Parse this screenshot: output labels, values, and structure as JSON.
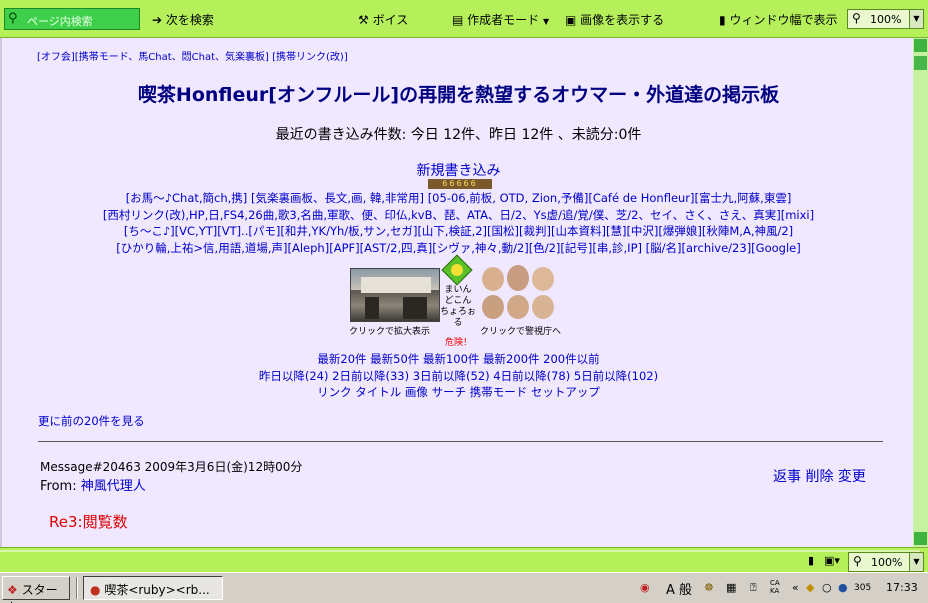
{
  "toolbar": {
    "search_placeholder": "ページ内検索",
    "find_next": "次を検索",
    "voice": "ボイス",
    "author_mode": "作成者モード",
    "show_images": "画像を表示する",
    "fit_width": "ウィンドウ幅で表示",
    "zoom": "100%"
  },
  "page": {
    "top_links": "[オフ会][携帯モード、馬Chat、悶Chat、気楽裏板] [携帯リンク(改)]",
    "title": "喫茶Honfleur[オンフルール]の再開を熱望するオウマー・外道達の掲示板",
    "stats": "最近の書き込み件数: 今日 12件、昨日 12件 、未読分:0件",
    "new_post": "新規書き込み",
    "counter": "66666",
    "link_rows": [
      "[お馬～♪Chat,簡ch,携] [気楽裏画板、長文,画, 韓,非常用] [05-06,前板, OTD, Zion,予備][Café de Honfleur][富士九,阿蘇,東雲]",
      "[西村リンク(改),HP,日,FS4,26曲,歌3,名曲,軍歌、便、印仏,kvB、琵、ATA、日/2、Ys虚/追/覚/僕、芝/2、セイ、さく、さえ、真実][mixi]",
      "[ち～こ♪][VC,YT][VT]..[パモ][和井,YK/Yh/板,サン,セガ][山下,検証,2][国松][裁判][山本資料][慧][中沢][爆弾娘][秋陣M,A,神風/2]",
      "[ひかり輪,上祐>信,用語,道場,声][Aleph][APF][AST/2,四,真][シヴァ,神々,動/2][色/2][記号][串,診,IP] [脳/名][archive/23][Google]"
    ],
    "img_caption_left": "クリックで拡大表示",
    "sign_text": [
      "まいん",
      "どこん",
      "ちょろぉ",
      "る"
    ],
    "danger": "危険！",
    "img_caption_right": "クリックで警視庁へ",
    "recent_row": "最新20件 最新50件 最新100件 最新200件 200件以前",
    "days_row": "昨日以降(24) 2日前以降(33) 3日前以降(52) 4日前以降(78) 5日前以降(102)",
    "nav_row": "リンク タイトル 画像 サーチ 携帯モード セットアップ",
    "prev20": "更に前の20件を見る",
    "message_line": "Message#20463 2009年3月6日(金)12時00分",
    "from_label": "From:",
    "from_name": "神風代理人",
    "actions": "返事 削除 変更",
    "subject": "Re3:閲覧数"
  },
  "status": {
    "zoom": "100%"
  },
  "taskbar": {
    "start": "スタート",
    "task": "喫茶<ruby><rb...",
    "ime": "A 般",
    "tray_num": "305",
    "time": "17:33"
  },
  "colors": {
    "toolbar": "#b5f05a",
    "page_bg": "#f0e8ff",
    "title": "#000080",
    "link": "#0000cc",
    "subject": "#dd0000"
  }
}
